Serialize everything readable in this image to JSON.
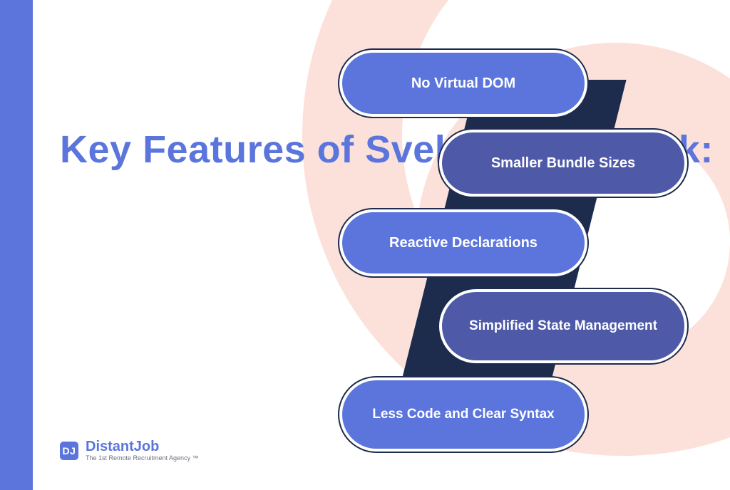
{
  "colors": {
    "brand_blue": "#5b75dd",
    "pill_light": "#5b75dd",
    "pill_dark": "#4e5aa8",
    "navy": "#1d2b4c",
    "peach": "#fbe1d9"
  },
  "title": "Key Features of Svelte Framework:",
  "features": [
    "No Virtual DOM",
    "Smaller Bundle Sizes",
    "Reactive Declarations",
    "Simplified State Management",
    "Less Code and Clear Syntax"
  ],
  "logo": {
    "mark": "DJ",
    "name": "DistantJob",
    "tagline": "The 1st Remote Recruitment Agency ™"
  }
}
